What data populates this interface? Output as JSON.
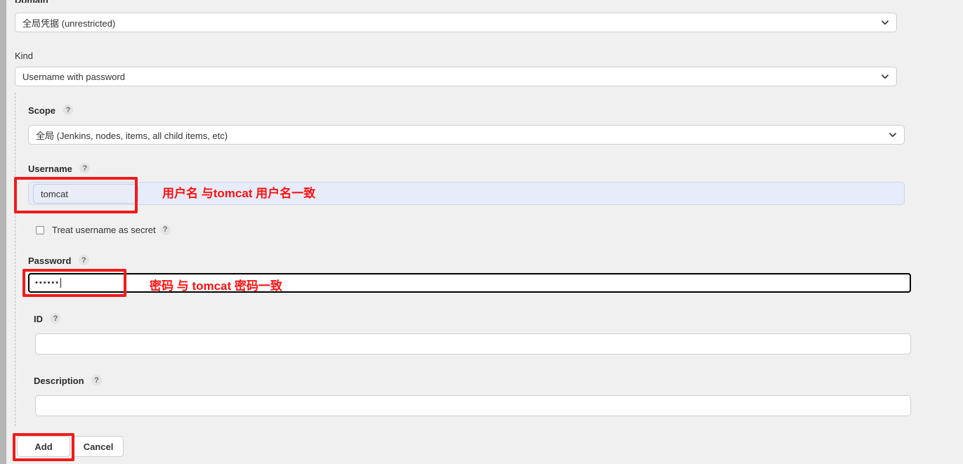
{
  "form": {
    "domain": {
      "label": "Domain",
      "value": "全局凭据 (unrestricted)",
      "icon": "chevron-down-icon"
    },
    "kind": {
      "label": "Kind",
      "value": "Username with password",
      "icon": "chevron-down-icon"
    },
    "scope": {
      "label": "Scope",
      "help": "?",
      "value": "全局 (Jenkins, nodes, items, all child items, etc)",
      "icon": "chevron-down-icon"
    },
    "username": {
      "label": "Username",
      "help": "?",
      "value": "tomcat",
      "placeholder": ""
    },
    "treat_secret": {
      "label": "Treat username as secret",
      "help": "?",
      "checked": false
    },
    "password": {
      "label": "Password",
      "help": "?",
      "value": "••••••",
      "placeholder": ""
    },
    "id": {
      "label": "ID",
      "help": "?",
      "value": "",
      "placeholder": ""
    },
    "description": {
      "label": "Description",
      "help": "?",
      "value": "",
      "placeholder": ""
    }
  },
  "buttons": {
    "add": "Add",
    "cancel": "Cancel"
  },
  "annotations": [
    {
      "text": "用户名 与tomcat 用户名一致"
    },
    {
      "text": "密码 与 tomcat 密码一致"
    }
  ],
  "colors": {
    "page_bg": "#f0f0f0",
    "annotation_red": "#ff1111",
    "highlight_blue": "#e6ecf9",
    "field_border": "#c9ced3"
  }
}
